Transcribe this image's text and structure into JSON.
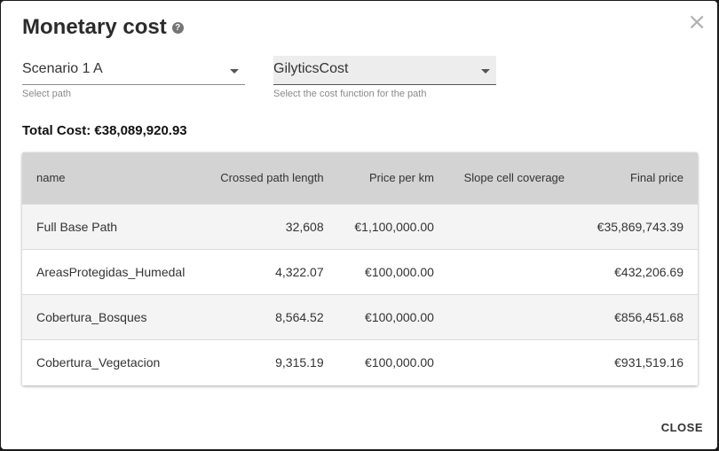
{
  "dialog": {
    "title": "Monetary cost",
    "help_icon": "?",
    "close_icon": "×",
    "close_label": "CLOSE"
  },
  "path_select": {
    "value": "Scenario 1 A",
    "helper": "Select path"
  },
  "cost_select": {
    "value": "GilyticsCost",
    "helper": "Select the cost function for the path"
  },
  "total_cost": "Total Cost: €38,089,920.93",
  "table": {
    "headers": [
      "name",
      "Crossed path length",
      "Price per km",
      "Slope cell coverage",
      "Final price"
    ],
    "rows": [
      {
        "name": "Full Base Path",
        "length": "32,608",
        "price_km": "€1,100,000.00",
        "slope": "",
        "final": "€35,869,743.39"
      },
      {
        "name": "AreasProtegidas_Humedal",
        "length": "4,322.07",
        "price_km": "€100,000.00",
        "slope": "",
        "final": "€432,206.69"
      },
      {
        "name": "Cobertura_Bosques",
        "length": "8,564.52",
        "price_km": "€100,000.00",
        "slope": "",
        "final": "€856,451.68"
      },
      {
        "name": "Cobertura_Vegetacion",
        "length": "9,315.19",
        "price_km": "€100,000.00",
        "slope": "",
        "final": "€931,519.16"
      }
    ]
  }
}
